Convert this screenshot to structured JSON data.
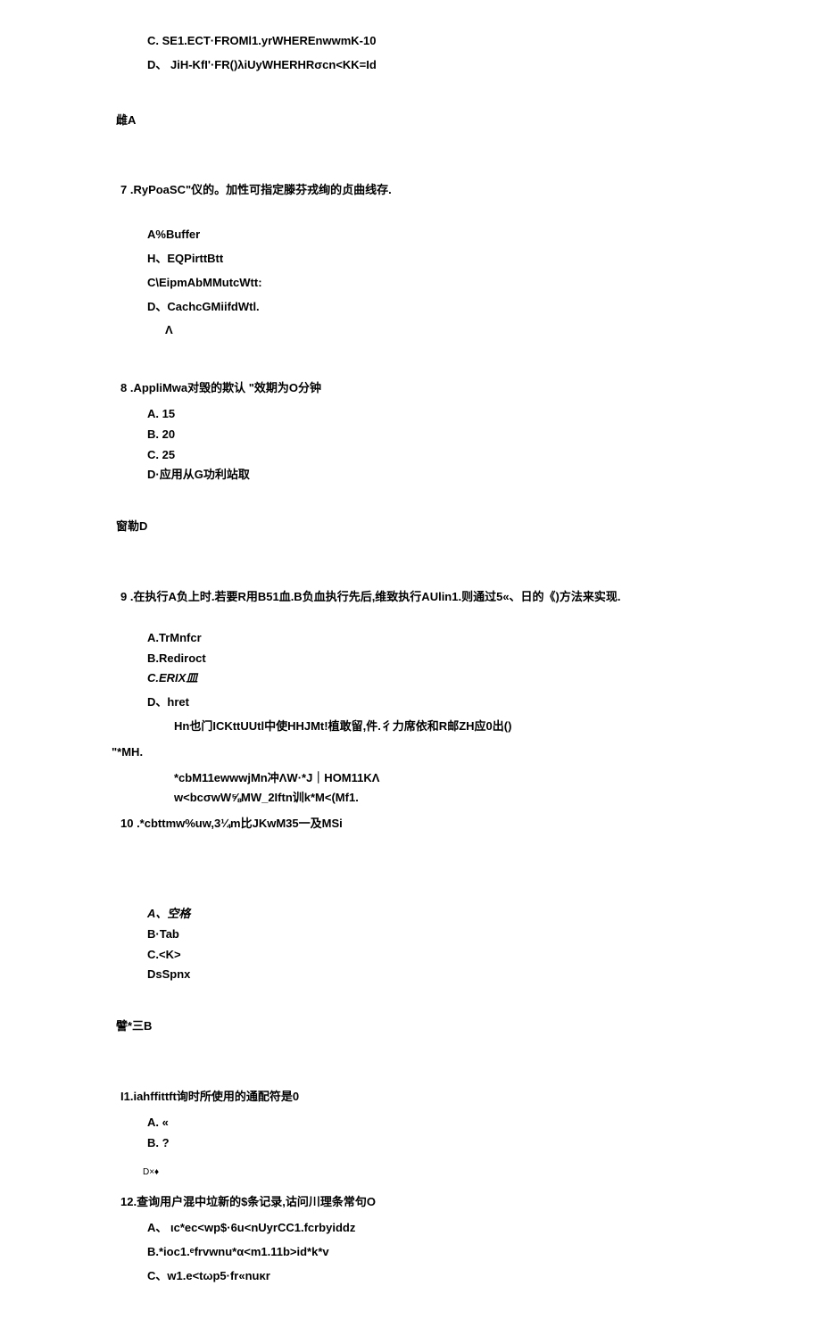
{
  "q6": {
    "optC": "C.      SE1.ECT·FROMl1.yrWHEREnwwmK-10",
    "optD": "D、 JiH-KfI'·FR()λiUyWHERHRσcn<KK=Id",
    "answer": "雌A"
  },
  "q7": {
    "text": "7     .RyPoaSC\"仪的。加性可指定滕芬戎绚的贞曲线存.",
    "optA": "A%Buffer",
    "optB": "H、EQPirttBtt",
    "optC": "C\\EipmAbMMutcWtt:",
    "optD": "D、CachcGMiifdWtl.",
    "answer": "Λ"
  },
  "q8": {
    "text": "8     .AppliMwa对毁的欺认 \"效期为O分钟",
    "optA": "A.      15",
    "optB": "B.      20",
    "optC": "C.      25",
    "optD": "D·应用从G功利站取",
    "answer": "窗勒D"
  },
  "q9": {
    "text": "9 .在执行A负上时.若要R用B51血.B负血执行先后,维致执行AUlin1.则通过5«、日的《)方法来实现.",
    "optA": "A.TrMnfcr",
    "optB": "B.Rediroct",
    "optC": "C.ERIX皿",
    "optD": "D、hret",
    "line1": "Hn也门ICKttUUtl中使HHJMt!植敢留,件.彳力席依和R邮ZH应0出()",
    "side": "\"*MH.",
    "line2": "*cbM11ewwwjMn冲ΛW·*J｜HOM11KΛ",
    "line3": "w<bcσwW⅝MW_2Iftn训k*M<(Mf1."
  },
  "q10": {
    "text": "10     .*cbttmw%uw,3¼m比JKwM35一及MSi",
    "optA": "A、空格",
    "optB": "B·Tab",
    "optC": "C.<K>",
    "optD": "DsSpnx",
    "answer": "譬*三B"
  },
  "q11": {
    "text": "I1.iahffittft询时所使用的通配符是0",
    "optA": "A.      «",
    "optB": "B.      ?",
    "answer": "D×♦"
  },
  "q12": {
    "text": "12.查询用户混中垃新的$条记录,诂问川理条常句O",
    "optA": "A、 ιc*ec<wp$·6u<nUyrCC1.fcrbyiddz",
    "optB": "B.*ioc1.ᵉfrvwnu*α<m1.11b>id*k*v",
    "optC": "C、w1.e<tωp5·fr«nuκr"
  }
}
